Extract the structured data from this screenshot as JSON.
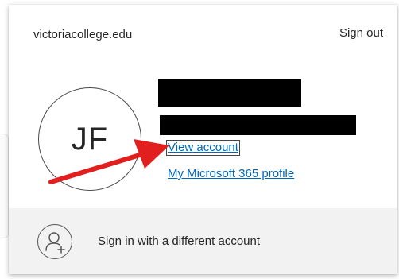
{
  "account": {
    "organization": "victoriacollege.edu",
    "sign_out_label": "Sign out",
    "avatar_initials": "JF",
    "view_account_label": "View account",
    "profile_link_label": "My Microsoft 365 profile"
  },
  "footer": {
    "switch_account_label": "Sign in with a different account",
    "icon": "add-person-icon"
  },
  "annotation": {
    "arrow_color": "#e11f1f"
  },
  "colors": {
    "link": "#0067b8",
    "footer_bg": "#f2f2f2",
    "text": "#262626"
  }
}
